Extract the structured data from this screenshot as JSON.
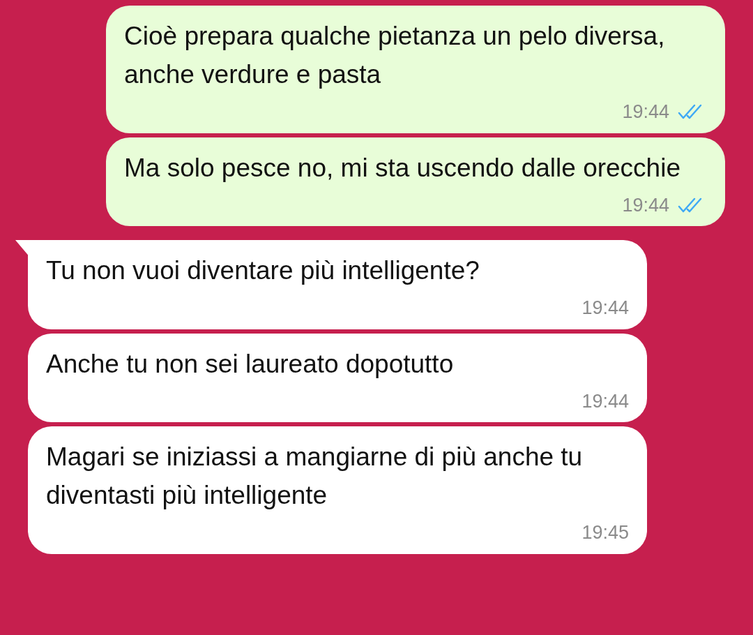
{
  "messages": [
    {
      "kind": "outgoing",
      "text": "Cioè prepara qualche pietanza un pelo diversa, anche verdure e pasta",
      "time": "19:44",
      "read": true,
      "tail": false
    },
    {
      "kind": "outgoing",
      "text": "Ma solo pesce no, mi sta uscendo dalle orecchie",
      "time": "19:44",
      "read": true,
      "tail": false
    },
    {
      "kind": "incoming",
      "text": "Tu non vuoi diventare più intelligente?",
      "time": "19:44",
      "tail": true
    },
    {
      "kind": "incoming",
      "text": "Anche tu non sei laureato dopotutto",
      "time": "19:44",
      "tail": false
    },
    {
      "kind": "incoming",
      "text": "Magari se iniziassi a mangiarne di più anche tu diventasti più intelligente",
      "time": "19:45",
      "tail": false
    }
  ]
}
